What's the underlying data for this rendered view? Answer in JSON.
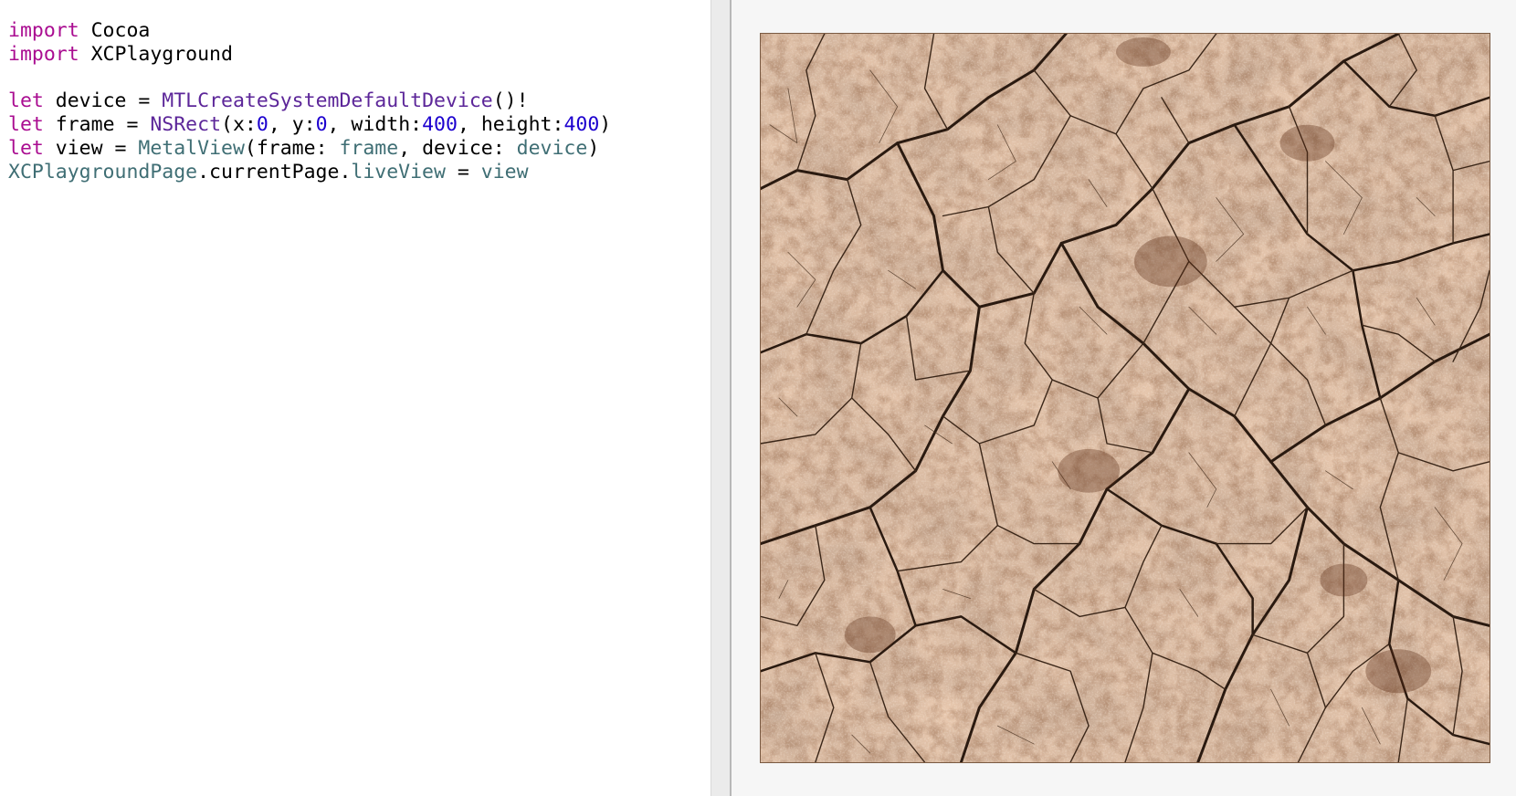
{
  "editor": {
    "lines": [
      [
        {
          "text": "import",
          "kind": "kw"
        },
        {
          "text": " Cocoa",
          "kind": "plain"
        }
      ],
      [
        {
          "text": "import",
          "kind": "kw"
        },
        {
          "text": " XCPlayground",
          "kind": "plain"
        }
      ],
      [],
      [
        {
          "text": "let",
          "kind": "kw"
        },
        {
          "text": " device = ",
          "kind": "plain"
        },
        {
          "text": "MTLCreateSystemDefaultDevice",
          "kind": "fn"
        },
        {
          "text": "()!",
          "kind": "plain"
        }
      ],
      [
        {
          "text": "let",
          "kind": "kw"
        },
        {
          "text": " frame = ",
          "kind": "plain"
        },
        {
          "text": "NSRect",
          "kind": "fn"
        },
        {
          "text": "(x:",
          "kind": "plain"
        },
        {
          "text": "0",
          "kind": "num"
        },
        {
          "text": ", y:",
          "kind": "plain"
        },
        {
          "text": "0",
          "kind": "num"
        },
        {
          "text": ", width:",
          "kind": "plain"
        },
        {
          "text": "400",
          "kind": "num"
        },
        {
          "text": ", height:",
          "kind": "plain"
        },
        {
          "text": "400",
          "kind": "num"
        },
        {
          "text": ")",
          "kind": "plain"
        }
      ],
      [
        {
          "text": "let",
          "kind": "kw"
        },
        {
          "text": " view = ",
          "kind": "plain"
        },
        {
          "text": "MetalView",
          "kind": "proj"
        },
        {
          "text": "(frame: ",
          "kind": "plain"
        },
        {
          "text": "frame",
          "kind": "proj"
        },
        {
          "text": ", device: ",
          "kind": "plain"
        },
        {
          "text": "device",
          "kind": "proj"
        },
        {
          "text": ")",
          "kind": "plain"
        }
      ],
      [
        {
          "text": "XCPlaygroundPage",
          "kind": "proj"
        },
        {
          "text": ".currentPage.",
          "kind": "plain"
        },
        {
          "text": "liveView",
          "kind": "proj"
        },
        {
          "text": " = ",
          "kind": "plain"
        },
        {
          "text": "view",
          "kind": "proj"
        }
      ]
    ]
  },
  "live_view": {
    "content": "cracked-earth-texture"
  },
  "colors": {
    "keyword": "#aa0d91",
    "number": "#1c00cf",
    "function": "#5c2699",
    "project_identifier": "#3f6e74",
    "plain_text": "#000000",
    "results_background": "#f6f6f6",
    "editor_background": "#ffffff"
  }
}
